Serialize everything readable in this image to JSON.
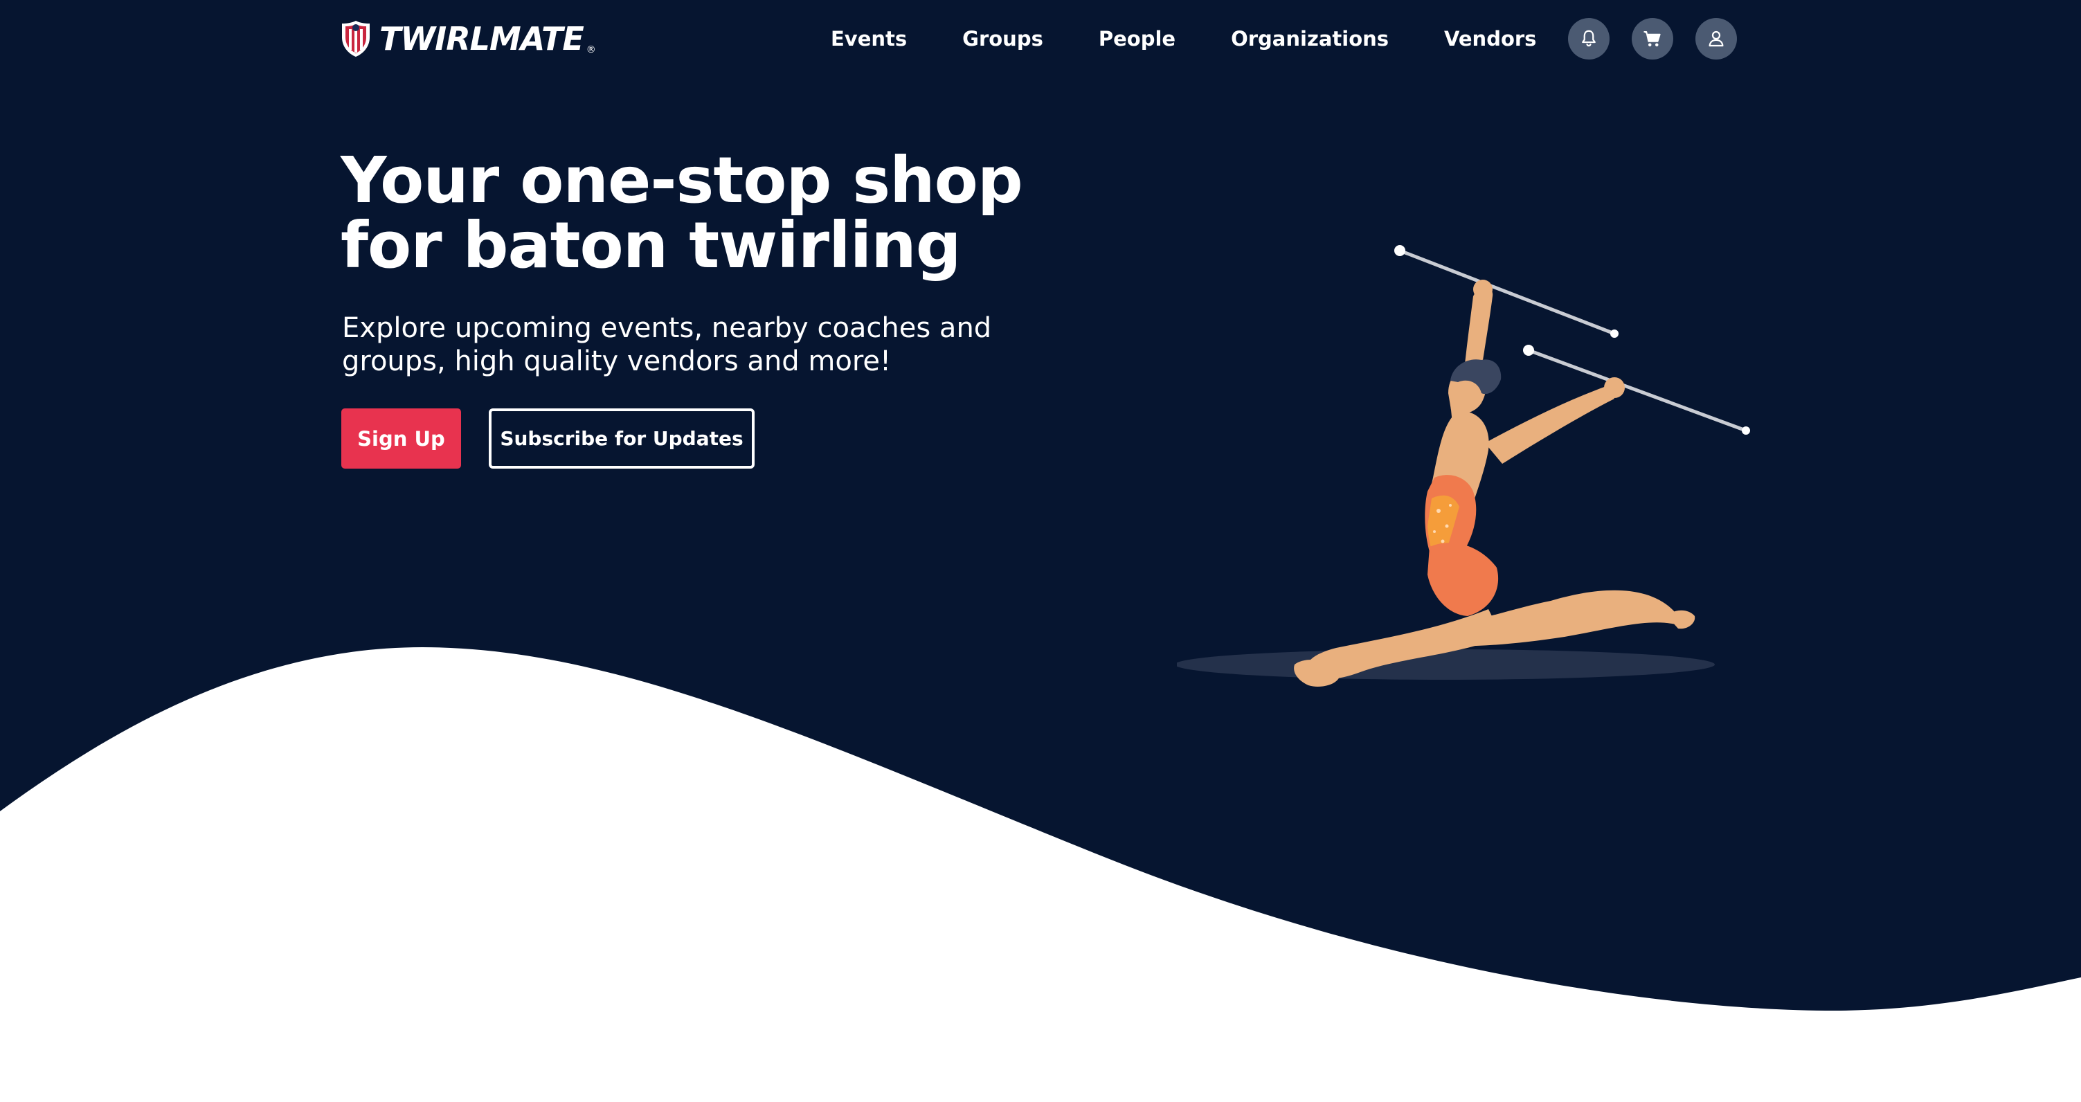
{
  "brand": {
    "name": "TWIRLMATE",
    "registered": "®"
  },
  "nav": {
    "items": [
      "Events",
      "Groups",
      "People",
      "Organizations",
      "Vendors"
    ],
    "icons": [
      "bell-icon",
      "cart-icon",
      "user-icon"
    ]
  },
  "hero": {
    "title_line1": "Your one-stop shop",
    "title_line2": "for baton twirling",
    "subtitle_line1": "Explore upcoming events, nearby coaches and",
    "subtitle_line2": "groups, high quality vendors and more!",
    "signup_label": "Sign Up",
    "subscribe_label": "Subscribe for Updates"
  },
  "colors": {
    "background": "#061530",
    "accent": "#e8334f",
    "icon_button": "#4b5a72",
    "lower_section": "#ffffff"
  }
}
